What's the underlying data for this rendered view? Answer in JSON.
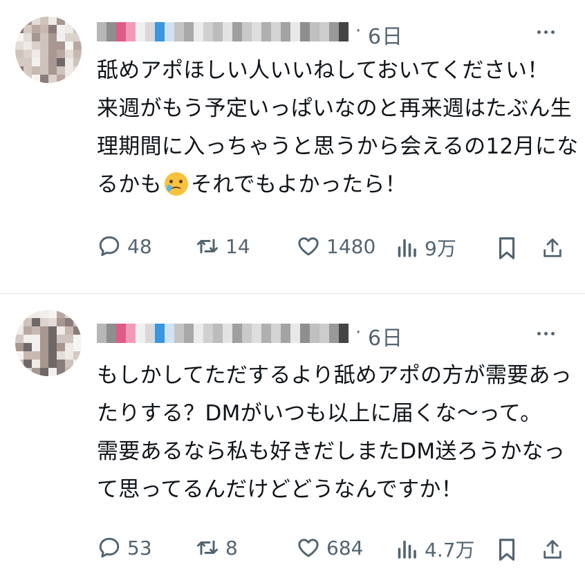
{
  "tweets": [
    {
      "time": "6日",
      "separator": "·",
      "lines": [
        "舐めアポほしい人いいねしておいてください！",
        "来週がもう予定いっぱいなのと再来週はたぶん生",
        "理期間に入っちゃうと思うから会えるの12月にな"
      ],
      "line4_before": "るかも",
      "line4_emoji": "face-holding-back-tears",
      "line4_after": "それでもよかったら！",
      "replies": "48",
      "retweets": "14",
      "likes": "1480",
      "views": "9万"
    },
    {
      "time": "6日",
      "separator": "·",
      "lines": [
        "もしかしてただするより舐めアポの方が需要あっ",
        "たりする？DMがいつも以上に届くな〜って。",
        "需要あるなら私も好きだしまたDM送ろうかなっ",
        "て思ってるんだけどどうなんですか！"
      ],
      "replies": "53",
      "retweets": "8",
      "likes": "684",
      "views": "4.7万"
    }
  ],
  "icons": {
    "reply": "reply-icon",
    "retweet": "retweet-icon",
    "like": "heart-icon",
    "views": "views-icon",
    "bookmark": "bookmark-icon",
    "share": "share-icon",
    "more": "more-icon"
  },
  "colors": {
    "text": "#0f1419",
    "secondary": "#536471",
    "divider": "#e6e9eb"
  }
}
